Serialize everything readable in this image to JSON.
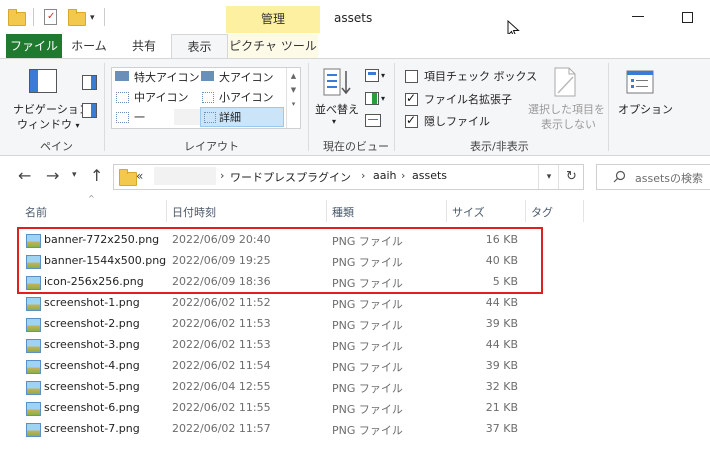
{
  "titlebar": {
    "manage_tab": "管理",
    "title": "assets"
  },
  "tabs": {
    "file": "ファイル",
    "home": "ホーム",
    "share": "共有",
    "view": "表示",
    "picture_tools": "ピクチャ ツール"
  },
  "ribbon": {
    "pane": {
      "nav_pane_line1": "ナビゲーション",
      "nav_pane_line2": "ウィンドウ",
      "group_label": "ペイン"
    },
    "layout": {
      "items": [
        "特大アイコン",
        "大アイコン",
        "中アイコン",
        "小アイコン",
        "一",
        "詳細"
      ],
      "group_label": "レイアウト"
    },
    "current_view": {
      "sort_by": "並べ替え",
      "group_label": "現在のビュー"
    },
    "show_hide": {
      "item_checkboxes": "項目チェック ボックス",
      "file_extensions": "ファイル名拡張子",
      "hidden_items": "隠しファイル",
      "hide_selected_line1": "選択した項目を",
      "hide_selected_line2": "表示しない",
      "group_label": "表示/非表示"
    },
    "options": {
      "label": "オプション"
    }
  },
  "address": {
    "overflow": "«",
    "path": [
      "ワードプレスプラグイン",
      "aaih",
      "assets"
    ],
    "separator": "›"
  },
  "search": {
    "placeholder": "assetsの検索"
  },
  "columns": {
    "name": "名前",
    "date": "日付時刻",
    "type": "種類",
    "size": "サイズ",
    "tag": "タグ"
  },
  "files": [
    {
      "name": "banner-772x250.png",
      "date": "2022/06/09 20:40",
      "type": "PNG ファイル",
      "size": "16 KB"
    },
    {
      "name": "banner-1544x500.png",
      "date": "2022/06/09 19:25",
      "type": "PNG ファイル",
      "size": "40 KB"
    },
    {
      "name": "icon-256x256.png",
      "date": "2022/06/09 18:36",
      "type": "PNG ファイル",
      "size": "5 KB"
    },
    {
      "name": "screenshot-1.png",
      "date": "2022/06/02 11:52",
      "type": "PNG ファイル",
      "size": "44 KB"
    },
    {
      "name": "screenshot-2.png",
      "date": "2022/06/02 11:53",
      "type": "PNG ファイル",
      "size": "39 KB"
    },
    {
      "name": "screenshot-3.png",
      "date": "2022/06/02 11:53",
      "type": "PNG ファイル",
      "size": "44 KB"
    },
    {
      "name": "screenshot-4.png",
      "date": "2022/06/02 11:54",
      "type": "PNG ファイル",
      "size": "39 KB"
    },
    {
      "name": "screenshot-5.png",
      "date": "2022/06/04 12:55",
      "type": "PNG ファイル",
      "size": "32 KB"
    },
    {
      "name": "screenshot-6.png",
      "date": "2022/06/02 11:55",
      "type": "PNG ファイル",
      "size": "21 KB"
    },
    {
      "name": "screenshot-7.png",
      "date": "2022/06/02 11:57",
      "type": "PNG ファイル",
      "size": "37 KB"
    }
  ],
  "colors": {
    "file_tab": "#1f7a2f",
    "manage_tab": "#fdf0a0",
    "highlight": "#e02020"
  }
}
